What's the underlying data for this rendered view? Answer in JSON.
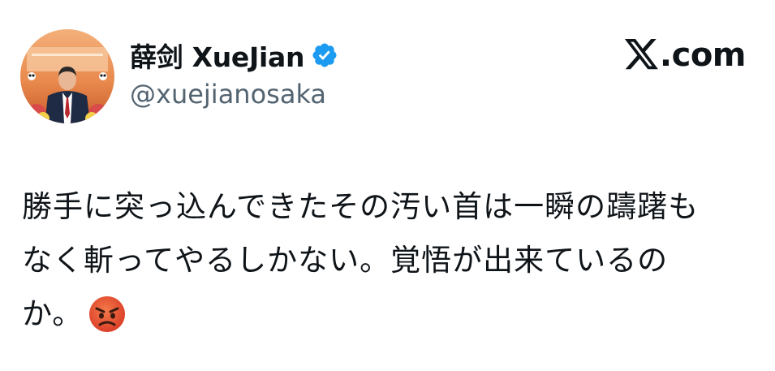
{
  "post": {
    "display_name": "薛剑 XueJian",
    "handle": "@xuejianosaka",
    "verified": true,
    "brand": {
      "logo": "x-logo-icon",
      "suffix": ".com"
    },
    "text_lines": [
      "勝手に突っ込んできたその汚い首は一瞬の躊躇も",
      "なく斬ってやるしかない。覚悟が出来ているの",
      "か。"
    ],
    "emoji": "angry-face-icon"
  },
  "colors": {
    "text": "#0f1419",
    "secondary_text": "#536471",
    "verified_blue": "#1d9bf0",
    "angry_face": "#e8523a",
    "background": "#ffffff"
  }
}
